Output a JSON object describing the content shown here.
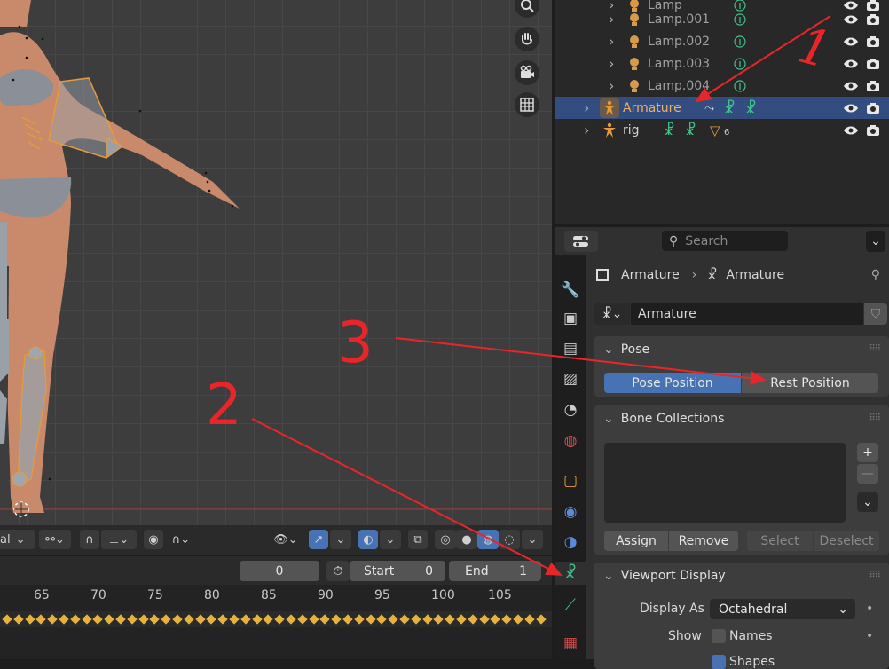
{
  "outliner": {
    "rows": [
      {
        "name": "Lamp",
        "type": "light"
      },
      {
        "name": "Lamp.001",
        "type": "light"
      },
      {
        "name": "Lamp.002",
        "type": "light"
      },
      {
        "name": "Lamp.003",
        "type": "light"
      },
      {
        "name": "Lamp.004",
        "type": "light"
      },
      {
        "name": "Armature",
        "type": "armature",
        "selected": true
      },
      {
        "name": "rig",
        "type": "armature",
        "badge": "6"
      }
    ]
  },
  "properties": {
    "search_placeholder": "Search",
    "breadcrumb": {
      "object": "Armature",
      "data": "Armature"
    },
    "datablock_name": "Armature",
    "pose": {
      "title": "Pose",
      "pose_position": "Pose Position",
      "rest_position": "Rest Position"
    },
    "bone_collections": {
      "title": "Bone Collections",
      "assign": "Assign",
      "remove": "Remove",
      "select": "Select",
      "deselect": "Deselect",
      "add": "+",
      "sub": "—"
    },
    "viewport_display": {
      "title": "Viewport Display",
      "display_as_label": "Display As",
      "display_as_value": "Octahedral",
      "show_label": "Show",
      "names_label": "Names",
      "shapes_label": "Shapes"
    }
  },
  "viewport": {
    "mode_label": "al"
  },
  "timeline": {
    "current_frame": "0",
    "start_label": "Start",
    "start_value": "0",
    "end_label": "End",
    "end_value": "1",
    "ticks": [
      "65",
      "70",
      "75",
      "80",
      "85",
      "90",
      "95",
      "100",
      "105"
    ]
  },
  "annotations": [
    "1",
    "2",
    "3"
  ],
  "colors": {
    "selection": "#334d80",
    "accent_blue": "#4772b3",
    "keyframe": "#e6b23b",
    "annotation": "#e8262a",
    "armature_orange": "#e89a3a",
    "bone_green": "#3ec48b"
  }
}
